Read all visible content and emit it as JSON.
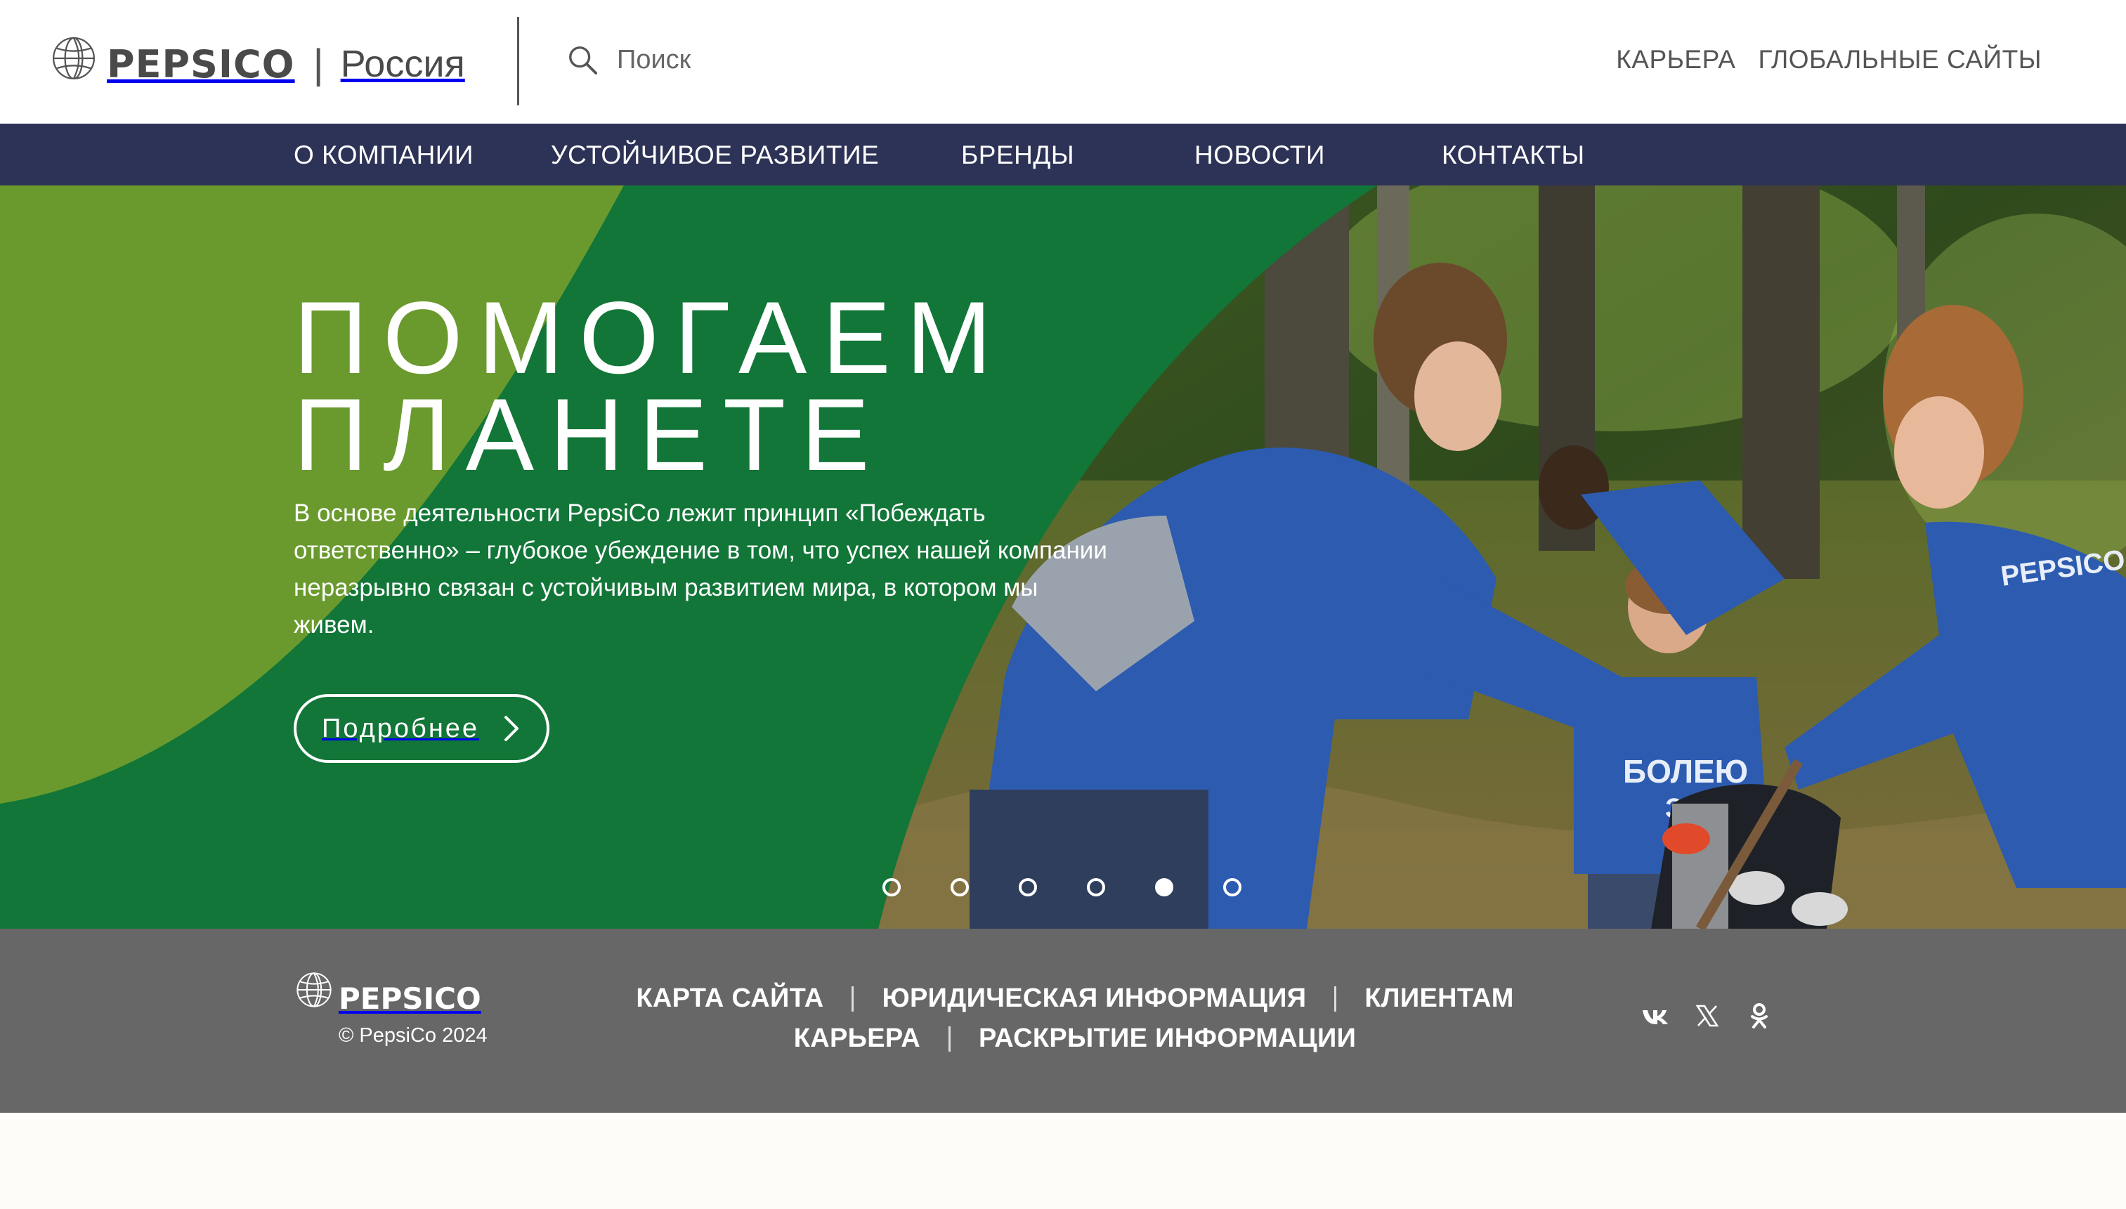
{
  "header": {
    "brand": "PEPSICO",
    "region_separator": "|",
    "region": "Россия",
    "search_placeholder": "Поиск",
    "top_links": [
      "КАРЬЕРА",
      "ГЛОБАЛЬНЫЕ САЙТЫ"
    ]
  },
  "nav": {
    "items": [
      "О КОМПАНИИ",
      "УСТОЙЧИВОЕ РАЗВИТИЕ",
      "БРЕНДЫ",
      "НОВОСТИ",
      "КОНТАКТЫ"
    ]
  },
  "hero": {
    "title_line1": "ПОМОГАЕМ",
    "title_line2": "ПЛАНЕТЕ",
    "text": "В основе деятельности PepsiCo лежит принцип «Побеждать ответственно» – глубокое убеждение в том, что успех нашей компании неразрывно связан с устойчивым развитием мира, в котором мы живем.",
    "button_label": "Подробнее",
    "photo_shirt_text_1": "БОЛЕЮ",
    "photo_shirt_text_2": "ЗА",
    "photo_shirt_text_3": "PEPSICO",
    "slide_count": 6,
    "active_slide": 5
  },
  "footer": {
    "brand": "PEPSICO",
    "copyright": "© PepsiCo 2024",
    "links_row1": [
      "КАРТА САЙТА",
      "ЮРИДИЧЕСКАЯ ИНФОРМАЦИЯ",
      "КЛИЕНТАМ"
    ],
    "links_row2": [
      "КАРЬЕРА",
      "РАСКРЫТИЕ ИНФОРМАЦИИ"
    ],
    "social": [
      "vk-icon",
      "x-twitter-icon",
      "odnoklassniki-icon"
    ]
  },
  "colors": {
    "nav_bg": "#2d3356",
    "hero_dark_green": "#127638",
    "hero_light_green": "#6a9a2e",
    "footer_bg": "#676767",
    "page_bg": "#fdfcf8"
  }
}
